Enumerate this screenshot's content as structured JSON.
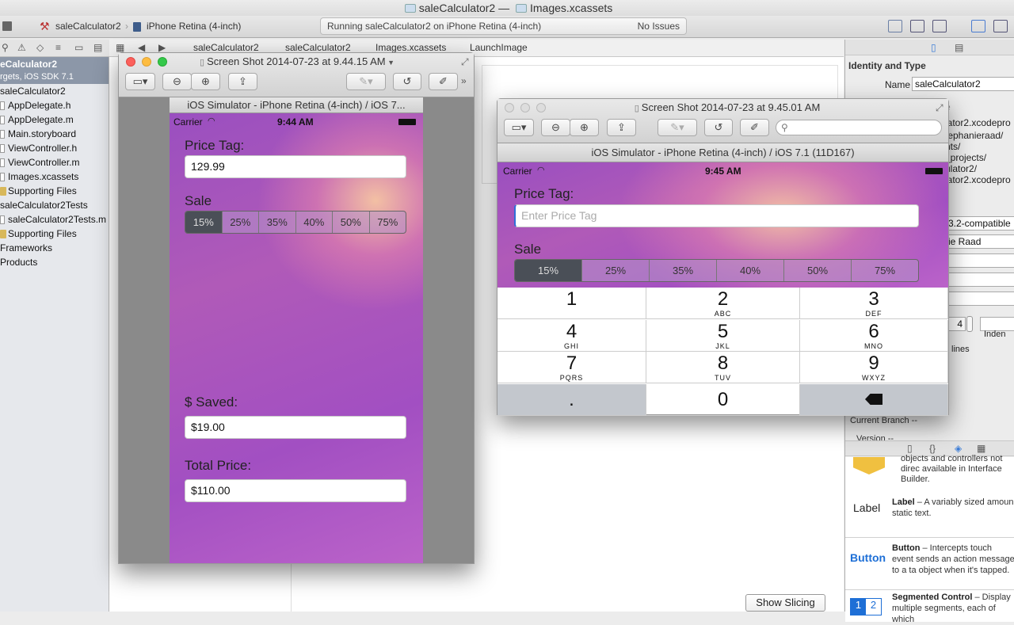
{
  "xcode": {
    "title_project": "saleCalculator2",
    "title_sep": "—",
    "title_file": "Images.xcassets",
    "scheme": "saleCalculator2",
    "device": "iPhone Retina (4-inch)",
    "status": "Running saleCalculator2 on iPhone Retina (4-inch)",
    "issues": "No Issues"
  },
  "navigator": {
    "project": "eCalculator2",
    "project_sub": "rgets, iOS SDK 7.1",
    "items": [
      {
        "label": "saleCalculator2",
        "kind": "group-top"
      },
      {
        "label": "AppDelegate.h",
        "kind": "file"
      },
      {
        "label": "AppDelegate.m",
        "kind": "file"
      },
      {
        "label": "Main.storyboard",
        "kind": "file"
      },
      {
        "label": "ViewController.h",
        "kind": "file"
      },
      {
        "label": "ViewController.m",
        "kind": "file"
      },
      {
        "label": "Images.xcassets",
        "kind": "file"
      },
      {
        "label": "Supporting Files",
        "kind": "folder"
      },
      {
        "label": "saleCalculator2Tests",
        "kind": "group-top"
      },
      {
        "label": "saleCalculator2Tests.m",
        "kind": "file"
      },
      {
        "label": "Supporting Files",
        "kind": "folder"
      },
      {
        "label": "Frameworks",
        "kind": "group-top"
      },
      {
        "label": "Products",
        "kind": "group-top"
      }
    ]
  },
  "jumpbar": {
    "crumbs": [
      "saleCalculator2",
      "saleCalculator2",
      "Images.xcassets",
      "LaunchImage"
    ]
  },
  "editor": {
    "show_slicing": "Show Slicing"
  },
  "inspector": {
    "identity_header": "Identity and Type",
    "name_label": "Name",
    "name_value": "saleCalculator2",
    "frag_1": "e",
    "frag_2": "lator2.xcodepro",
    "frag_3": "tephanieraad/",
    "frag_4": "nts/",
    "frag_5": "_projects/",
    "frag_6": "ulator2/",
    "frag_7": "lator2.xcodepro",
    "compat": "3.2-compatible",
    "org": "ie Raad",
    "indent_num": "4",
    "indent_label": "Inden",
    "lines_label": "lines",
    "current_branch_label": "Current Branch",
    "current_branch_value": "--",
    "version_label": "Version",
    "version_value": "--",
    "library": [
      {
        "icon": "Object",
        "title": "",
        "desc": "objects and controllers not direc available in Interface Builder."
      },
      {
        "icon": "Label",
        "title": "Label",
        "desc": " – A variably sized amoun static text."
      },
      {
        "icon": "Button",
        "title": "Button",
        "desc": " – Intercepts touch event sends an action message to a ta object when it's tapped."
      },
      {
        "icon": "1 2",
        "title": "Segmented Control",
        "desc": " – Display multiple segments, each of which"
      }
    ]
  },
  "preview1": {
    "title": "Screen Shot 2014-07-23 at 9.44.15 AM",
    "sim_title": "iOS Simulator - iPhone Retina (4-inch) / iOS 7...",
    "carrier": "Carrier",
    "time": "9:44 AM",
    "price_label": "Price Tag:",
    "price_value": "129.99",
    "sale_label": "Sale",
    "segments": [
      "15%",
      "25%",
      "35%",
      "40%",
      "50%",
      "75%"
    ],
    "saved_label": "$ Saved:",
    "saved_value": "$19.00",
    "total_label": "Total Price:",
    "total_value": "$110.00"
  },
  "preview2": {
    "title": "Screen Shot 2014-07-23 at 9.45.01 AM",
    "sim_title": "iOS Simulator - iPhone Retina (4-inch) / iOS 7.1 (11D167)",
    "carrier": "Carrier",
    "time": "9:45 AM",
    "price_label": "Price Tag:",
    "price_placeholder": "Enter Price Tag",
    "sale_label": "Sale",
    "segments": [
      "15%",
      "25%",
      "35%",
      "40%",
      "50%",
      "75%"
    ],
    "keys": [
      {
        "n": "1",
        "l": ""
      },
      {
        "n": "2",
        "l": "ABC"
      },
      {
        "n": "3",
        "l": "DEF"
      },
      {
        "n": "4",
        "l": "GHI"
      },
      {
        "n": "5",
        "l": "JKL"
      },
      {
        "n": "6",
        "l": "MNO"
      },
      {
        "n": "7",
        "l": "PQRS"
      },
      {
        "n": "8",
        "l": "TUV"
      },
      {
        "n": "9",
        "l": "WXYZ"
      },
      {
        "n": ".",
        "l": ""
      },
      {
        "n": "0",
        "l": ""
      },
      {
        "n": "",
        "l": ""
      }
    ]
  }
}
